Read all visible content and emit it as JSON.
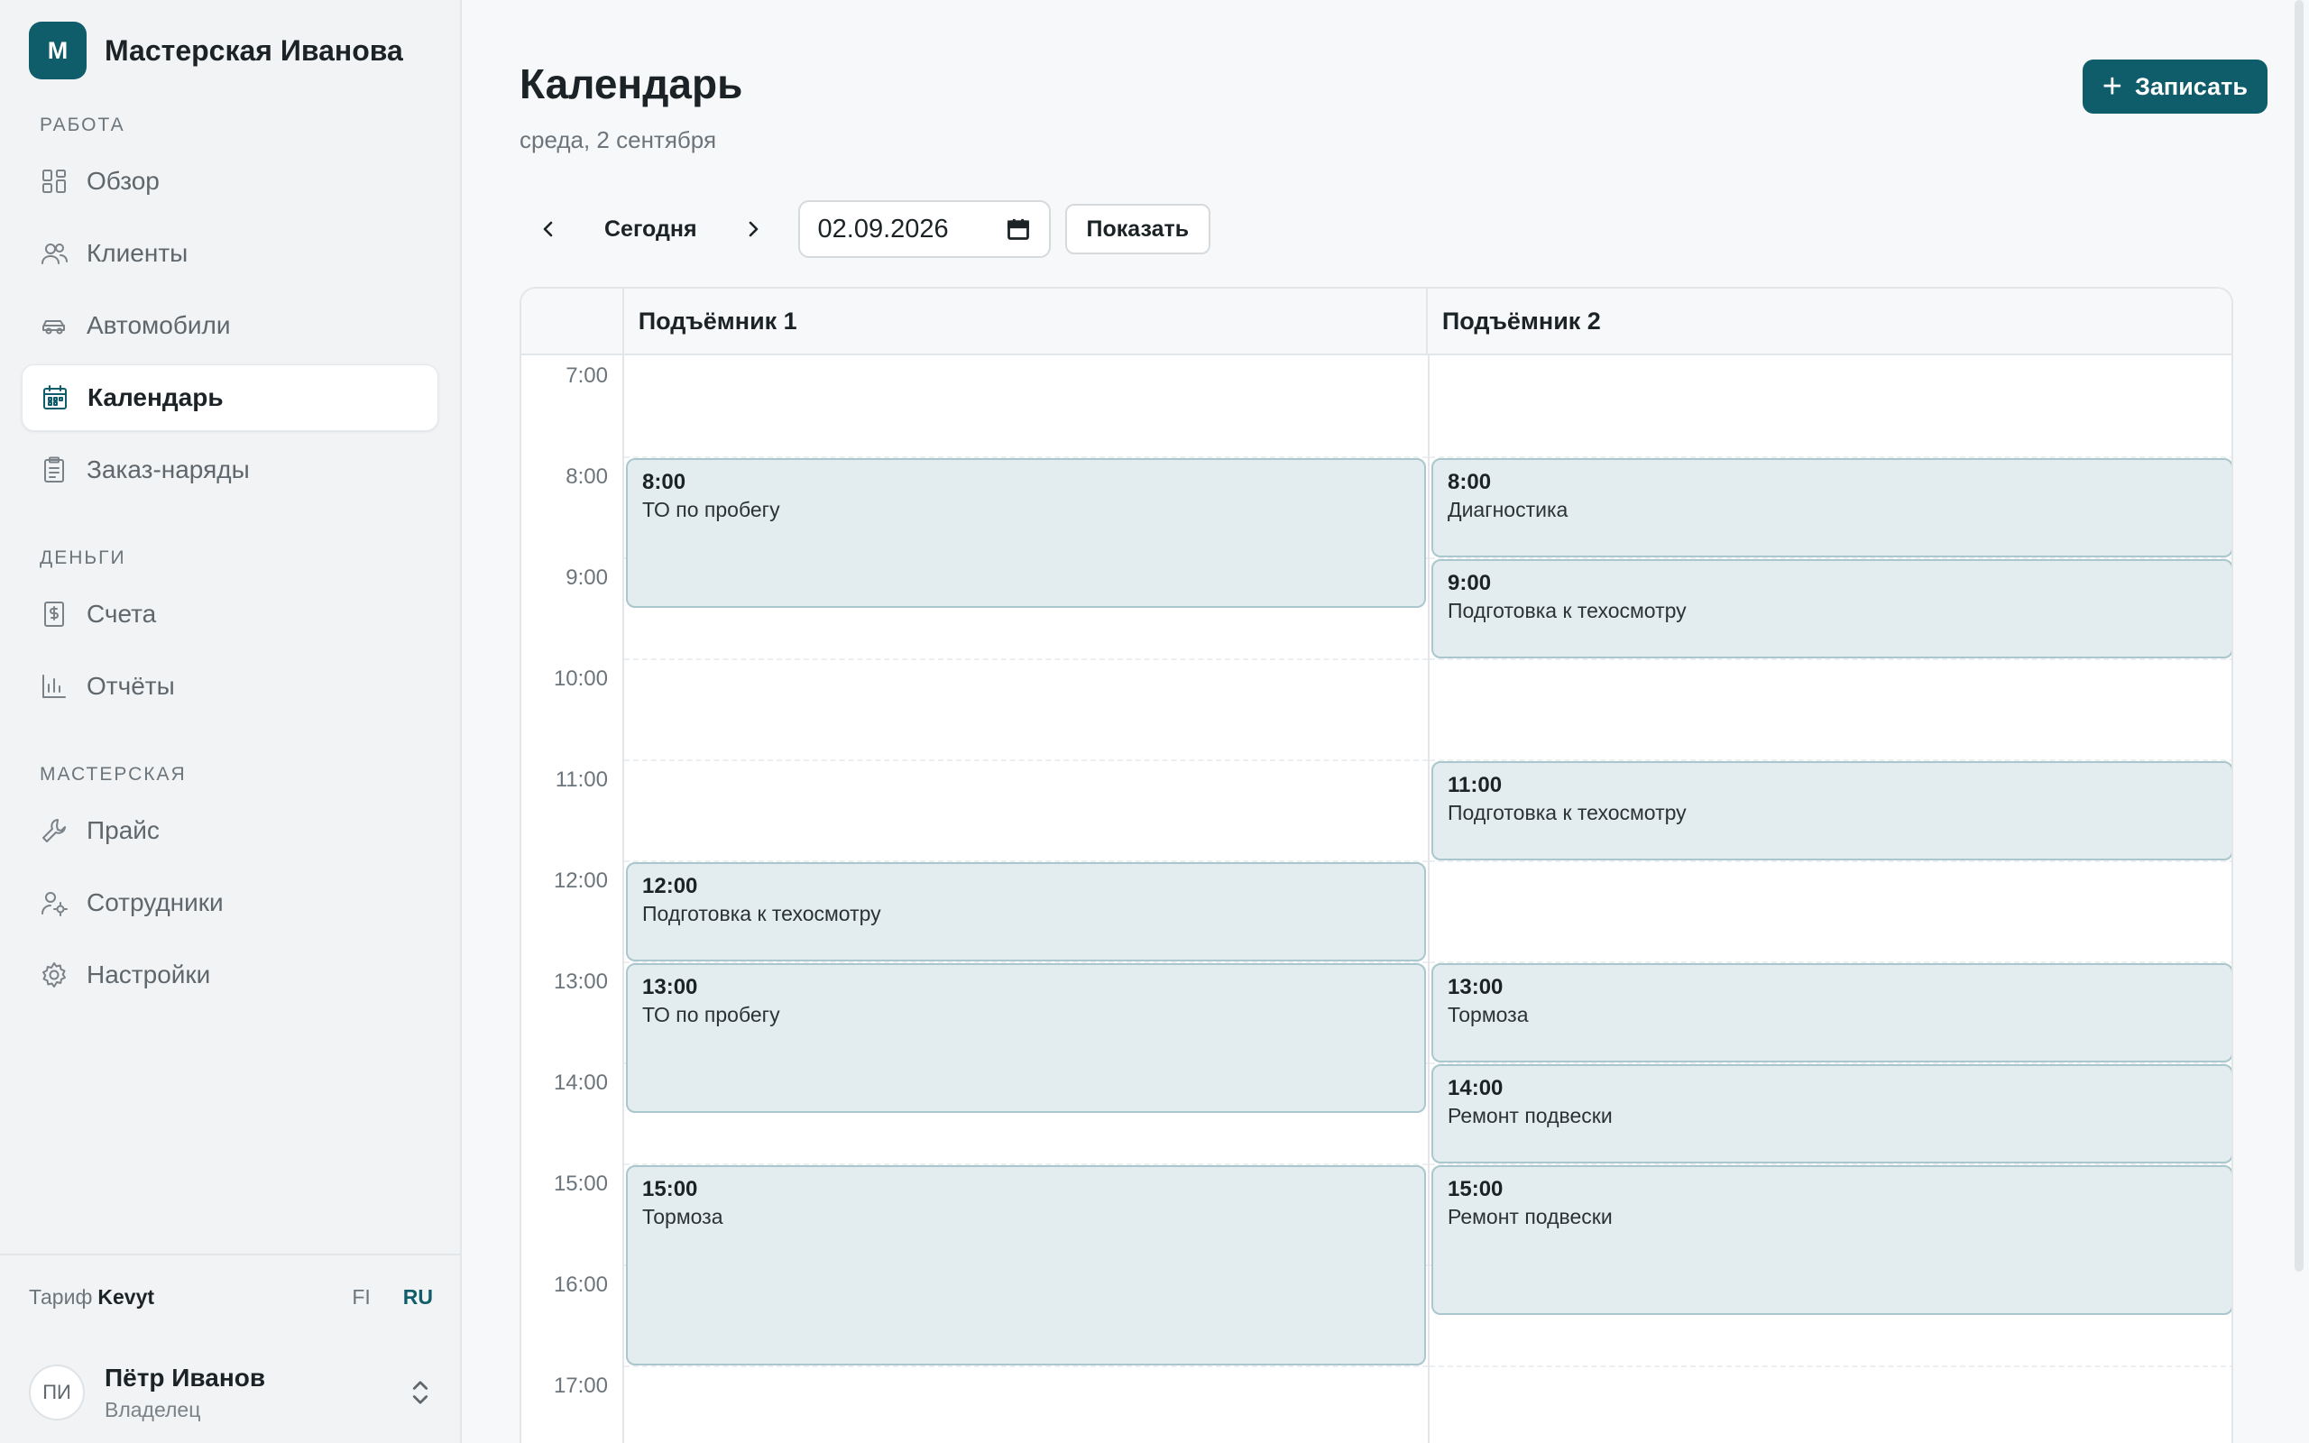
{
  "brand": {
    "logo_letter": "M",
    "name": "Мастерская Иванова"
  },
  "sidebar": {
    "sections": [
      {
        "title": "РАБОТА",
        "items": [
          {
            "label": "Обзор",
            "icon": "grid-icon"
          },
          {
            "label": "Клиенты",
            "icon": "users-icon"
          },
          {
            "label": "Автомобили",
            "icon": "car-icon"
          },
          {
            "label": "Календарь",
            "icon": "calendar-icon",
            "active": true
          },
          {
            "label": "Заказ-наряды",
            "icon": "clipboard-icon"
          }
        ]
      },
      {
        "title": "ДЕНЬГИ",
        "items": [
          {
            "label": "Счета",
            "icon": "invoice-icon"
          },
          {
            "label": "Отчёты",
            "icon": "bar-chart-icon"
          }
        ]
      },
      {
        "title": "МАСТЕРСКАЯ",
        "items": [
          {
            "label": "Прайс",
            "icon": "wrench-icon"
          },
          {
            "label": "Сотрудники",
            "icon": "user-gear-icon"
          },
          {
            "label": "Настройки",
            "icon": "gear-icon"
          }
        ]
      }
    ],
    "plan": {
      "prefix": "Тариф",
      "name": "Kevyt"
    },
    "languages": [
      {
        "code": "FI",
        "active": false
      },
      {
        "code": "RU",
        "active": true
      }
    ],
    "user": {
      "initials": "ПИ",
      "name": "Пётр Иванов",
      "role": "Владелец"
    }
  },
  "header": {
    "title": "Календарь",
    "subtitle": "среда, 2 сентября",
    "add_button": "Записать"
  },
  "toolbar": {
    "today": "Сегодня",
    "date_value": "02.09.2026",
    "show_button": "Показать"
  },
  "calendar": {
    "columns": [
      "Подъёмник 1",
      "Подъёмник 2"
    ],
    "hours": [
      "7:00",
      "8:00",
      "9:00",
      "10:00",
      "11:00",
      "12:00",
      "13:00",
      "14:00",
      "15:00",
      "16:00",
      "17:00"
    ],
    "events": [
      {
        "column": 0,
        "start": 8,
        "duration": 1.5,
        "time": "8:00",
        "title": "ТО по пробегу"
      },
      {
        "column": 0,
        "start": 12,
        "duration": 1,
        "time": "12:00",
        "title": "Подготовка к техосмотру"
      },
      {
        "column": 0,
        "start": 13,
        "duration": 1.5,
        "time": "13:00",
        "title": "ТО по пробегу"
      },
      {
        "column": 0,
        "start": 15,
        "duration": 2,
        "time": "15:00",
        "title": "Тормоза"
      },
      {
        "column": 1,
        "start": 8,
        "duration": 1,
        "time": "8:00",
        "title": "Диагностика"
      },
      {
        "column": 1,
        "start": 9,
        "duration": 1,
        "time": "9:00",
        "title": "Подготовка к техосмотру"
      },
      {
        "column": 1,
        "start": 11,
        "duration": 1,
        "time": "11:00",
        "title": "Подготовка к техосмотру"
      },
      {
        "column": 1,
        "start": 13,
        "duration": 1,
        "time": "13:00",
        "title": "Тормоза"
      },
      {
        "column": 1,
        "start": 14,
        "duration": 1,
        "time": "14:00",
        "title": "Ремонт подвески"
      },
      {
        "column": 1,
        "start": 15,
        "duration": 1.5,
        "time": "15:00",
        "title": "Ремонт подвески"
      }
    ]
  },
  "colors": {
    "accent": "#0f5d6b",
    "event_bg": "#e3ecee",
    "event_border": "#a9c7cd"
  }
}
